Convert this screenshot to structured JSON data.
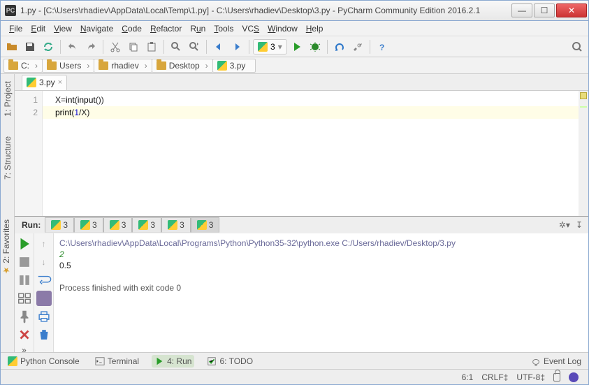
{
  "window": {
    "title": "1.py - [C:\\Users\\rhadiev\\AppData\\Local\\Temp\\1.py] - C:\\Users\\rhadiev\\Desktop\\3.py - PyCharm Community Edition 2016.2.1"
  },
  "menu": [
    "File",
    "Edit",
    "View",
    "Navigate",
    "Code",
    "Refactor",
    "Run",
    "Tools",
    "VCS",
    "Window",
    "Help"
  ],
  "run_config": {
    "selected": "3"
  },
  "breadcrumb": [
    "C:",
    "Users",
    "rhadiev",
    "Desktop",
    "3.py"
  ],
  "left_tabs": {
    "project": "1: Project",
    "structure": "7: Structure",
    "favorites": "2: Favorites"
  },
  "editor": {
    "tab": "3.py",
    "lines": [
      "1",
      "2"
    ],
    "code": {
      "l1_var": "X",
      "l1_eq": "=",
      "l1_int": "int",
      "l1_op": "(",
      "l1_in": "input",
      "l1_op2": "()",
      "l1_cl": ")",
      "l2_print": "print",
      "l2_op": "(",
      "l2_num": "1",
      "l2_div": "/",
      "l2_var": "X",
      "l2_cl": ")"
    }
  },
  "run_tabs": [
    "3",
    "3",
    "3",
    "3",
    "3",
    "3"
  ],
  "run_label": "Run:",
  "output": {
    "cmd": "C:\\Users\\rhadiev\\AppData\\Local\\Programs\\Python\\Python35-32\\python.exe C:/Users/rhadiev/Desktop/3.py",
    "input": "2",
    "result": "0.5",
    "exit": "Process finished with exit code 0"
  },
  "bottom_tabs": {
    "console": "Python Console",
    "terminal": "Terminal",
    "run": "4: Run",
    "todo": "6: TODO",
    "eventlog": "Event Log"
  },
  "status": {
    "pos": "6:1",
    "eol": "CRLF‡",
    "enc": "UTF-8‡"
  }
}
